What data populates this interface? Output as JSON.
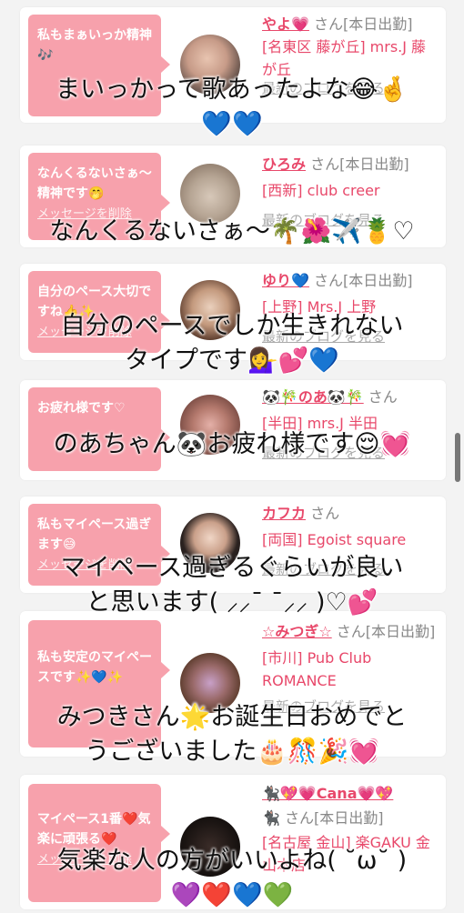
{
  "cards": [
    {
      "bubble": "私もまぁいっか精神🎶",
      "link": "",
      "name": "やよ💗",
      "suffix": "さん[本日出勤]",
      "shop": "[名東区 藤が丘] mrs.J 藤が丘",
      "blog": "最新のブログを見る",
      "overlay1": "まいっかって歌あったよな😂🤞",
      "overlay2": "💙💙"
    },
    {
      "bubble": "なんくるないさぁ〜精神です🤭",
      "link": "メッセージを削除",
      "name": "ひろみ",
      "suffix": "さん[本日出勤]",
      "shop": "[西新] club creer",
      "blog": "最新のブログを見る",
      "overlay1": "なんくるないさぁ〜🌴🌺✈️🍍♡",
      "overlay2": ""
    },
    {
      "bubble": "自分のペース大切ですね👍✨",
      "link": "メッセージを削除",
      "name": "ゆり💙",
      "suffix": "さん[本日出勤]",
      "shop": "[上野] Mrs.J 上野",
      "blog": "最新のブログを見る",
      "overlay1": "自分のペースでしか生きれない",
      "overlay2": "タイプです💁‍♀️💕💙"
    },
    {
      "bubble": "お疲れ様です♡",
      "link": "",
      "name": "🐼🎋のあ🐼🎋",
      "suffix": "さん",
      "shop": "[半田] mrs.J 半田",
      "blog": "最新のブログを見る",
      "overlay1": "のあちゃん🐼お疲れ様です😌💓",
      "overlay2": ""
    },
    {
      "bubble": "私もマイペース過ぎます😅",
      "link": "メッセージを削除",
      "name": "カフカ",
      "suffix": "さん",
      "shop": "[両国] Egoist square",
      "blog": "最新のブログを見る",
      "overlay1": "マイペース過ぎるぐらいが良い",
      "overlay2": "と思います( ⸝⸝¯ ¯⸝⸝ )♡💕"
    },
    {
      "bubble": "私も安定のマイペースです✨💙✨",
      "link": "",
      "name": "☆みつぎ☆",
      "suffix": "さん[本日出勤]",
      "shop": "[市川] Pub Club ROMANCE",
      "blog": "最新のブログを見る",
      "overlay1": "みつきさん🌟お誕生日おめでと",
      "overlay2": "うございました🎂🎊🎉💓"
    },
    {
      "bubble": "マイペース1番❤️気楽に頑張る❤️",
      "link": "メッセージを削除",
      "name": "🐈‍⬛💖💗Cana💗💖",
      "suffix": "🐈‍⬛ さん[本日出勤]",
      "shop": "[名古屋 金山] 楽GAKU 金山本店",
      "blog": "",
      "overlay1": "気楽な人の方がいいよね( ˘ω˘ )",
      "overlay2": "💜❤️💙💚"
    }
  ],
  "colors": {
    "accent": "#e8486a",
    "bubble": "#f7a1ac"
  }
}
